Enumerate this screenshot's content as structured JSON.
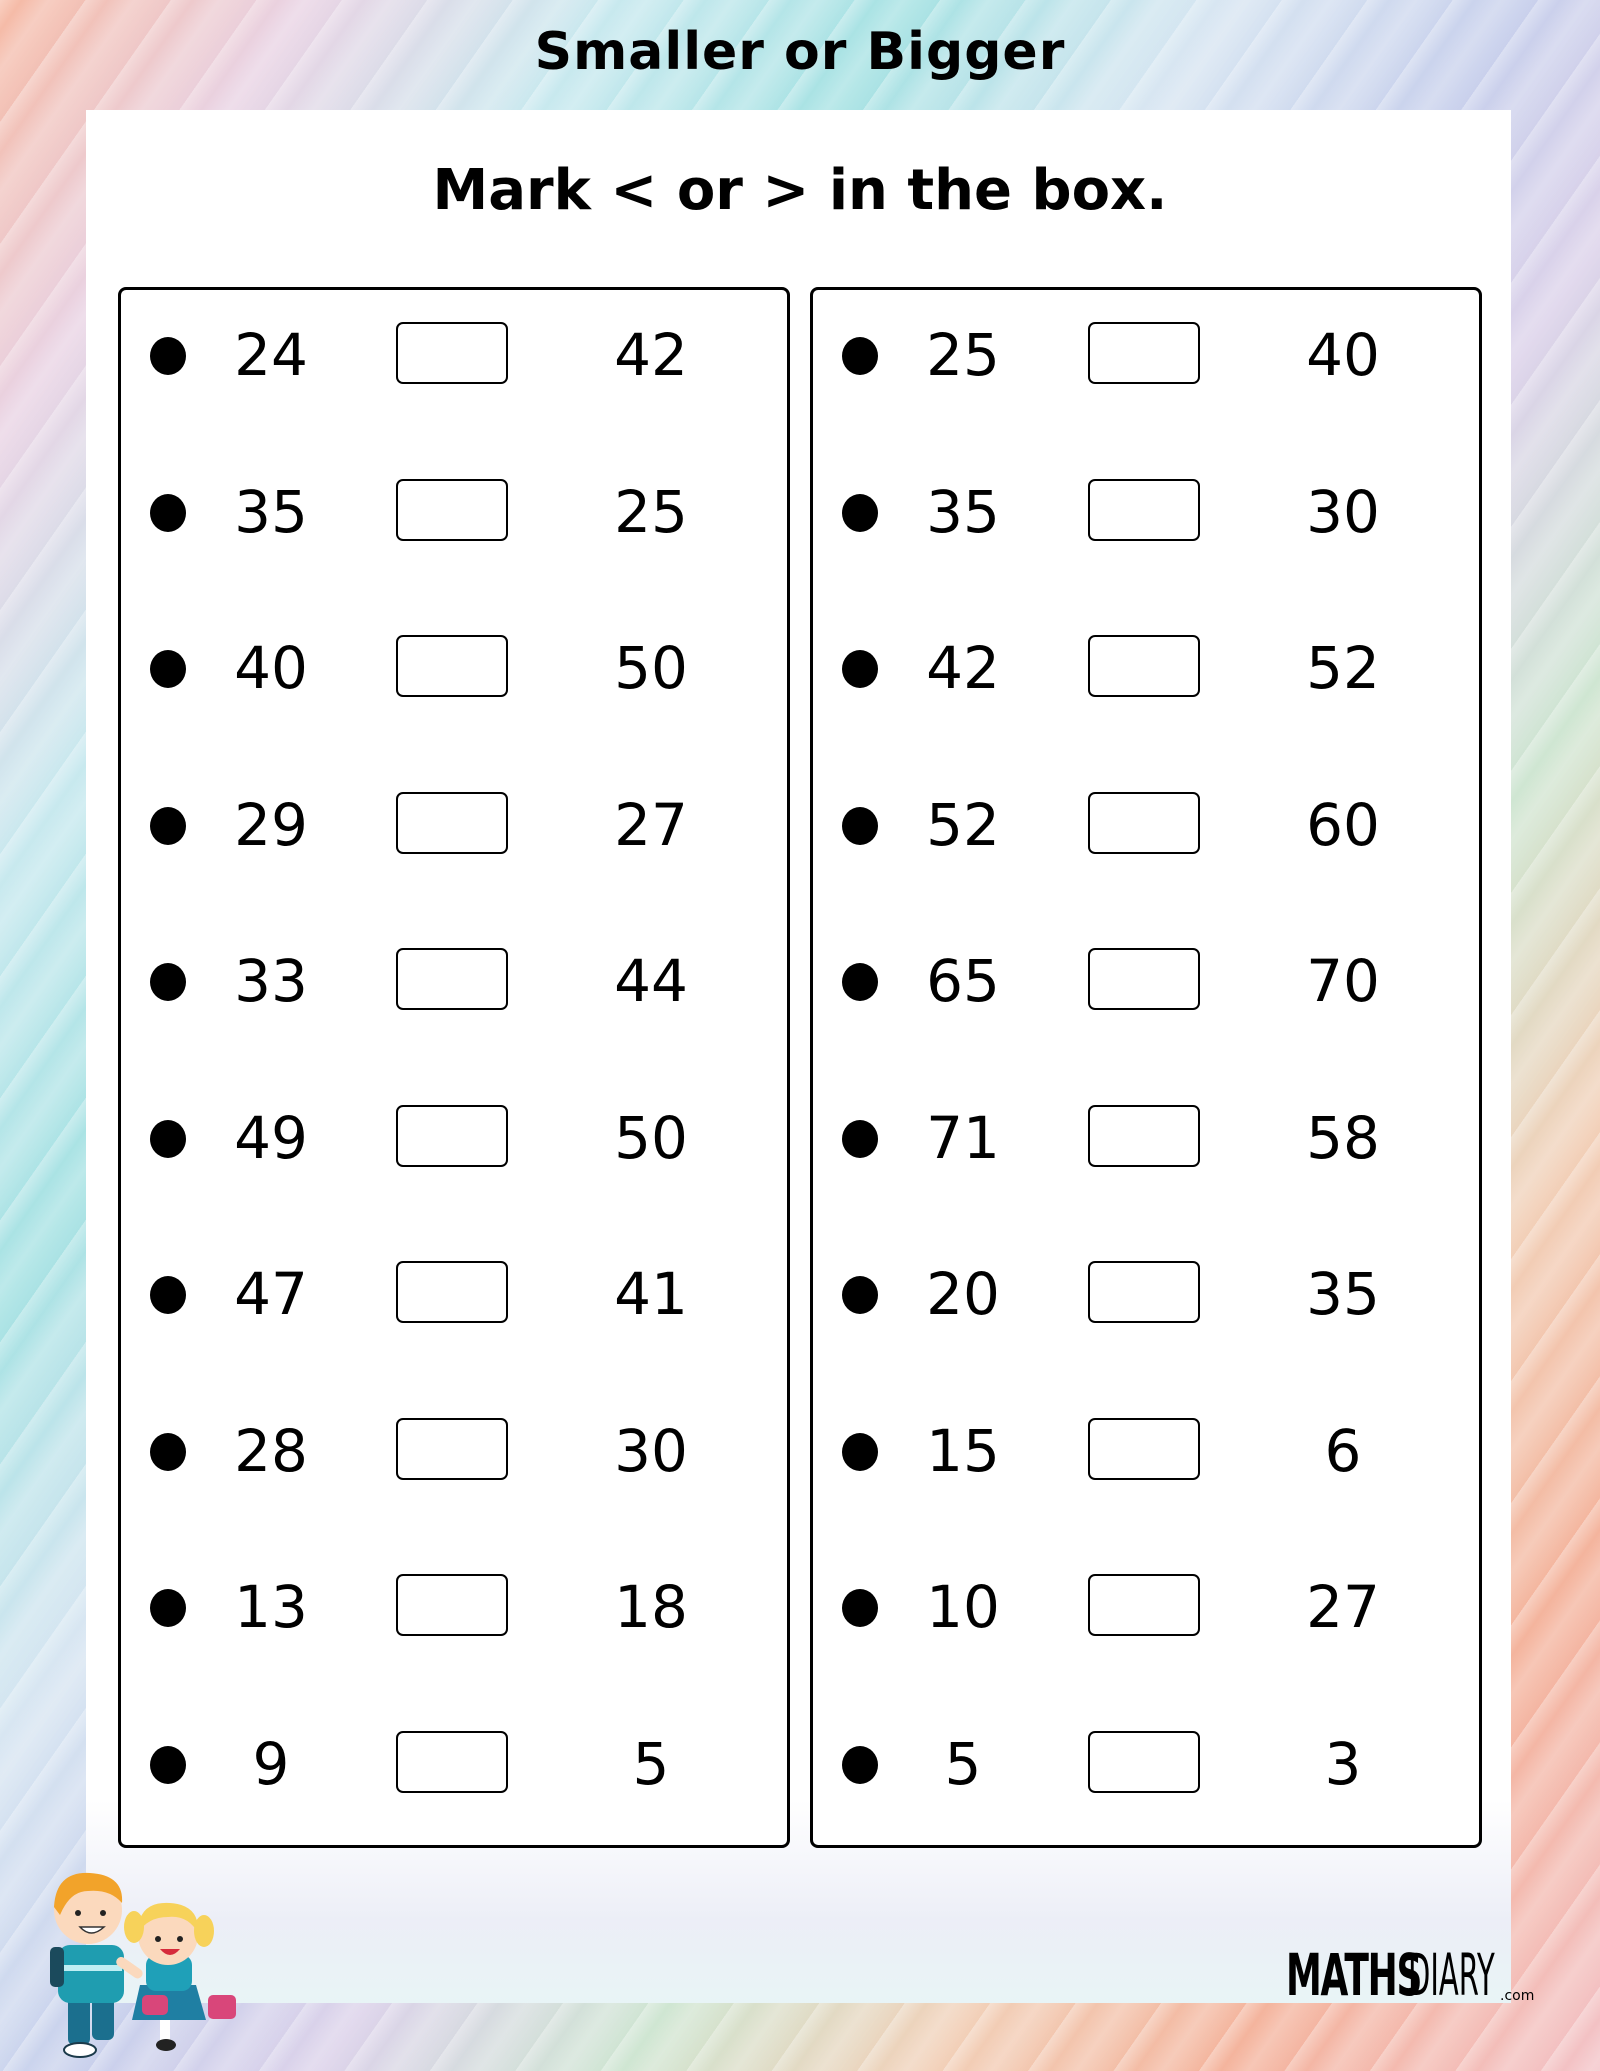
{
  "worksheet": {
    "title": "Smaller or Bigger",
    "instruction": "Mark < or > in the box."
  },
  "left_column": [
    {
      "a": "24",
      "b": "42"
    },
    {
      "a": "35",
      "b": "25"
    },
    {
      "a": "40",
      "b": "50"
    },
    {
      "a": "29",
      "b": "27"
    },
    {
      "a": "33",
      "b": "44"
    },
    {
      "a": "49",
      "b": "50"
    },
    {
      "a": "47",
      "b": "41"
    },
    {
      "a": "28",
      "b": "30"
    },
    {
      "a": "13",
      "b": "18"
    },
    {
      "a": "9",
      "b": "5"
    }
  ],
  "right_column": [
    {
      "a": "25",
      "b": "40"
    },
    {
      "a": "35",
      "b": "30"
    },
    {
      "a": "42",
      "b": "52"
    },
    {
      "a": "52",
      "b": "60"
    },
    {
      "a": "65",
      "b": "70"
    },
    {
      "a": "71",
      "b": "58"
    },
    {
      "a": "20",
      "b": "35"
    },
    {
      "a": "15",
      "b": "6"
    },
    {
      "a": "10",
      "b": "27"
    },
    {
      "a": "5",
      "b": "3"
    }
  ],
  "answer_box_value": "",
  "logo": {
    "bold_part": "MATHS",
    "thin_part": "DIARY",
    "suffix": ".com"
  },
  "illustration": "two-kids-walking-to-school",
  "colors": {
    "text": "#000000",
    "sheet": "#ffffff",
    "boy_shirt": "#1f9db0",
    "boy_hair": "#f2a32a",
    "girl_hair": "#f7d25a",
    "girl_bag": "#d9467a"
  }
}
